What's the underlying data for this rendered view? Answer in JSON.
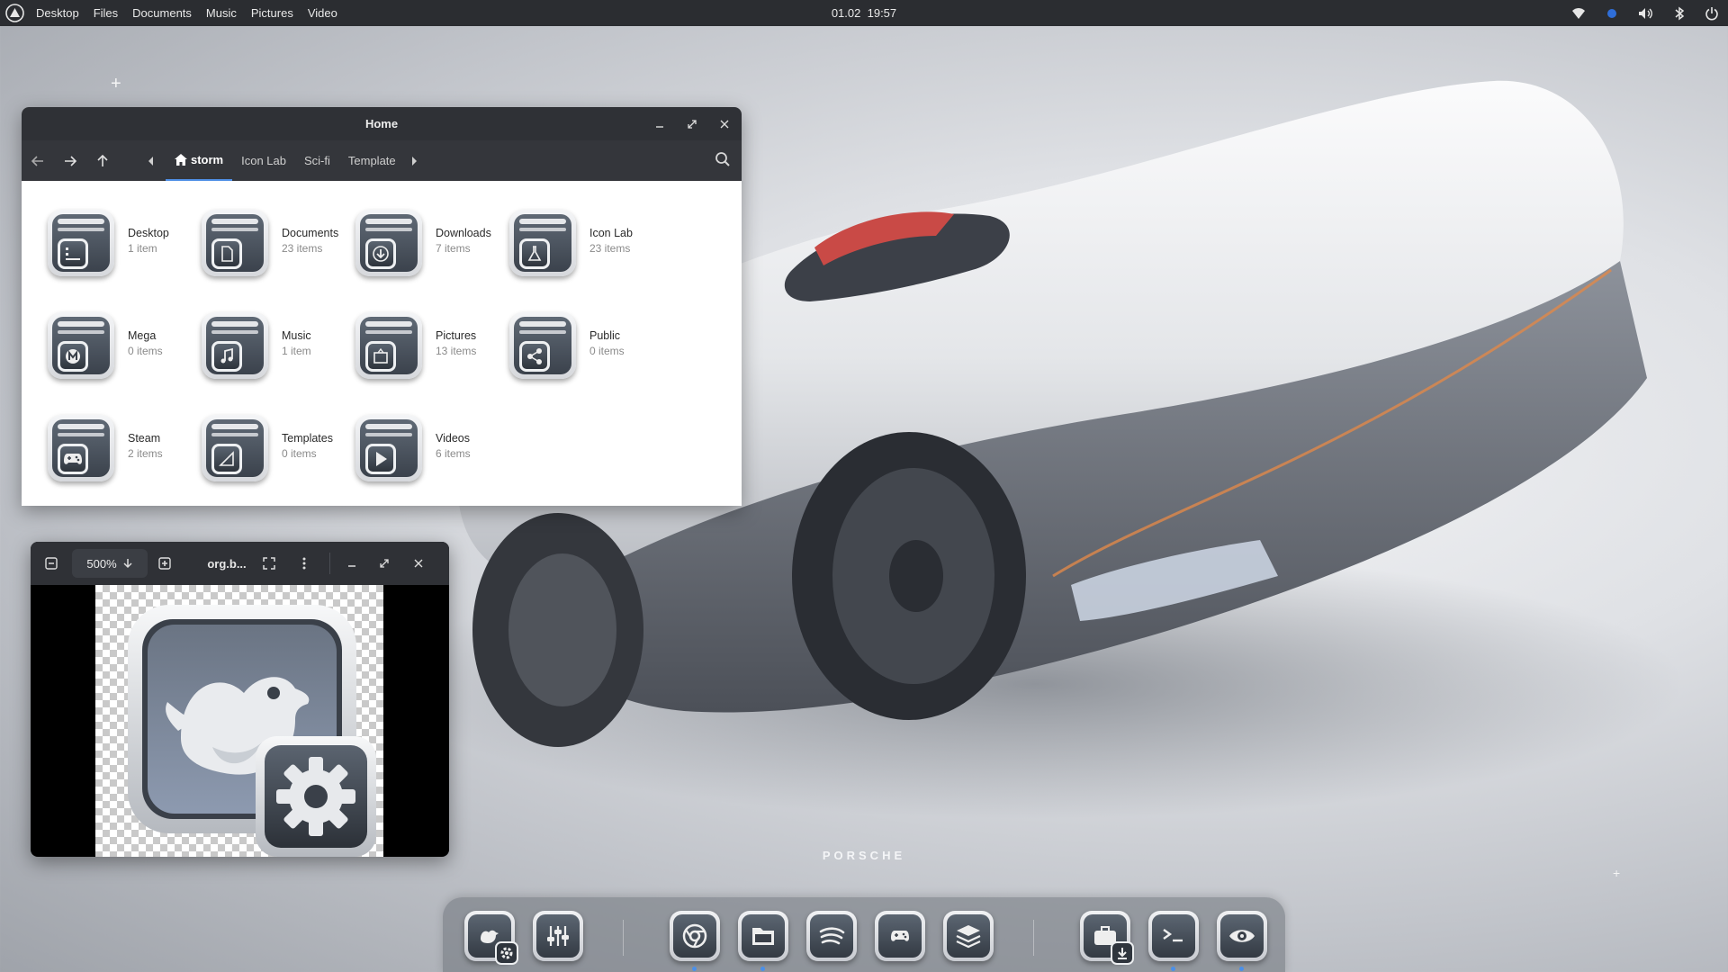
{
  "topbar": {
    "menu": [
      "Desktop",
      "Files",
      "Documents",
      "Music",
      "Pictures",
      "Video"
    ],
    "clock_date": "01.02",
    "clock_time": "19:57",
    "tray_icons": [
      "wifi-icon",
      "notification-dot-icon",
      "volume-icon",
      "bluetooth-icon",
      "power-icon"
    ]
  },
  "wallpaper": {
    "brand": "PORSCHE"
  },
  "file_manager": {
    "title": "Home",
    "breadcrumbs": [
      "storm",
      "Icon Lab",
      "Sci-fi",
      "Template"
    ],
    "active_crumb": "storm",
    "items": [
      {
        "name": "Desktop",
        "count": "1 item",
        "icon": "desktop-icon"
      },
      {
        "name": "Documents",
        "count": "23 items",
        "icon": "document-icon"
      },
      {
        "name": "Downloads",
        "count": "7 items",
        "icon": "download-icon"
      },
      {
        "name": "Icon Lab",
        "count": "23 items",
        "icon": "flask-icon"
      },
      {
        "name": "Mega",
        "count": "0 items",
        "icon": "mega-icon"
      },
      {
        "name": "Music",
        "count": "1 item",
        "icon": "music-note-icon"
      },
      {
        "name": "Pictures",
        "count": "13 items",
        "icon": "picture-icon"
      },
      {
        "name": "Public",
        "count": "0 items",
        "icon": "share-icon"
      },
      {
        "name": "Steam",
        "count": "2 items",
        "icon": "gamepad-icon"
      },
      {
        "name": "Templates",
        "count": "0 items",
        "icon": "template-icon"
      },
      {
        "name": "Videos",
        "count": "6 items",
        "icon": "play-icon"
      }
    ]
  },
  "image_viewer": {
    "zoom": "500%",
    "filename": "org.b...",
    "image_icon": "bird-settings-icon"
  },
  "dock": {
    "apps": [
      {
        "name": "app-settings",
        "icon": "bird-settings-icon",
        "running": false
      },
      {
        "name": "mixer",
        "icon": "sliders-icon",
        "running": false
      },
      {
        "name": "browser",
        "icon": "browser-icon",
        "running": true
      },
      {
        "name": "files",
        "icon": "folder-icon",
        "running": true
      },
      {
        "name": "music-player",
        "icon": "music-stream-icon",
        "running": false
      },
      {
        "name": "games",
        "icon": "gamepad-icon",
        "running": false
      },
      {
        "name": "layers",
        "icon": "layers-icon",
        "running": false
      },
      {
        "name": "software-center",
        "icon": "briefcase-download-icon",
        "running": false
      },
      {
        "name": "terminal",
        "icon": "terminal-icon",
        "running": true
      },
      {
        "name": "image-viewer",
        "icon": "eye-icon",
        "running": true
      }
    ]
  }
}
